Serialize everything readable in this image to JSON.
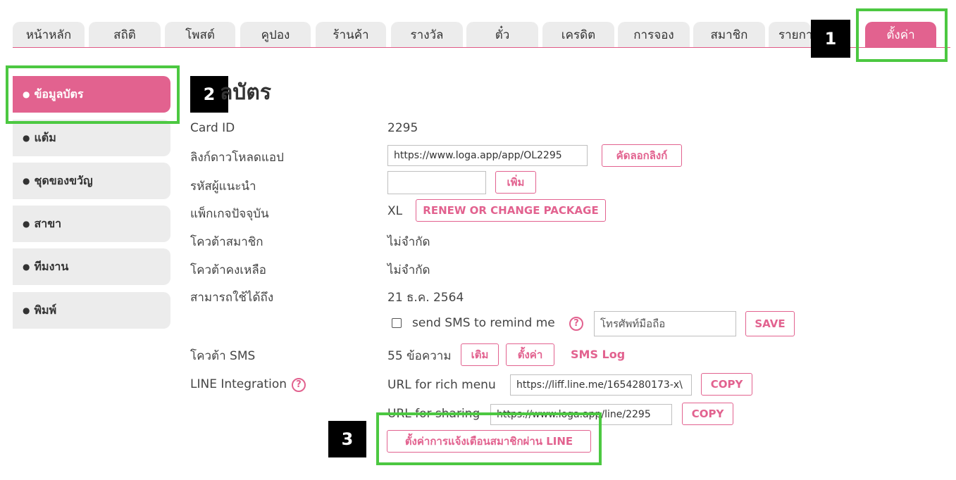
{
  "tabs": [
    {
      "label": "หน้าหลัก"
    },
    {
      "label": "สถิติ"
    },
    {
      "label": "โพสต์"
    },
    {
      "label": "คูปอง"
    },
    {
      "label": "ร้านค้า"
    },
    {
      "label": "รางวัล"
    },
    {
      "label": "ตั๋ว"
    },
    {
      "label": "เครดิต"
    },
    {
      "label": "การจอง"
    },
    {
      "label": "สมาชิก"
    },
    {
      "label": "รายกา"
    },
    {
      "label": "ตั้งค่า"
    }
  ],
  "badges": {
    "one": "1",
    "two": "2",
    "three": "3"
  },
  "sidebar": {
    "bullet": "●",
    "items": [
      {
        "label": "ข้อมูลบัตร"
      },
      {
        "label": "แต้ม"
      },
      {
        "label": "ชุดของขวัญ"
      },
      {
        "label": "สาขา"
      },
      {
        "label": "ทีมงาน"
      },
      {
        "label": "พิมพ์"
      }
    ]
  },
  "page": {
    "title": "ลบัตร",
    "card_id": {
      "label": "Card ID",
      "value": "2295"
    },
    "download_link": {
      "label": "ลิงก์ดาวโหลดแอป",
      "value": "https://www.loga.app/app/OL2295",
      "button": "คัดลอกลิงก์"
    },
    "referral": {
      "label": "รหัสผู้แนะนำ",
      "value": "",
      "button": "เพิ่ม"
    },
    "package": {
      "label": "แพ็กเกจปัจจุบัน",
      "value": "XL",
      "button": "RENEW OR CHANGE PACKAGE"
    },
    "member_quota": {
      "label": "โควต้าสมาชิก",
      "value": "ไม่จำกัด"
    },
    "quota_left": {
      "label": "โควต้าคงเหลือ",
      "value": "ไม่จำกัด"
    },
    "valid_until": {
      "label": "สามารถใช้ได้ถึง",
      "value": "21 ธ.ค. 2564"
    },
    "sms_remind": {
      "text": "send SMS to remind me",
      "help": "?",
      "placeholder": "โทรศัพท์มือถือ",
      "button": "SAVE"
    },
    "sms_quota": {
      "label": "โควต้า SMS",
      "value": "55 ข้อความ",
      "topup_button": "เติม",
      "settings_button": "ตั้งค่า",
      "log_link": "SMS Log"
    },
    "line": {
      "label": "LINE Integration",
      "help": "?",
      "rich_menu_label": "URL for rich menu",
      "rich_menu_url": "https://liff.line.me/1654280173-x\\",
      "rich_copy": "COPY",
      "sharing_label": "URL for sharing",
      "sharing_url": "https://www.loga.app/line/2295",
      "sharing_copy": "COPY",
      "notify_button": "ตั้งค่าการแจ้งเตือนสมาชิกผ่าน LINE"
    }
  }
}
